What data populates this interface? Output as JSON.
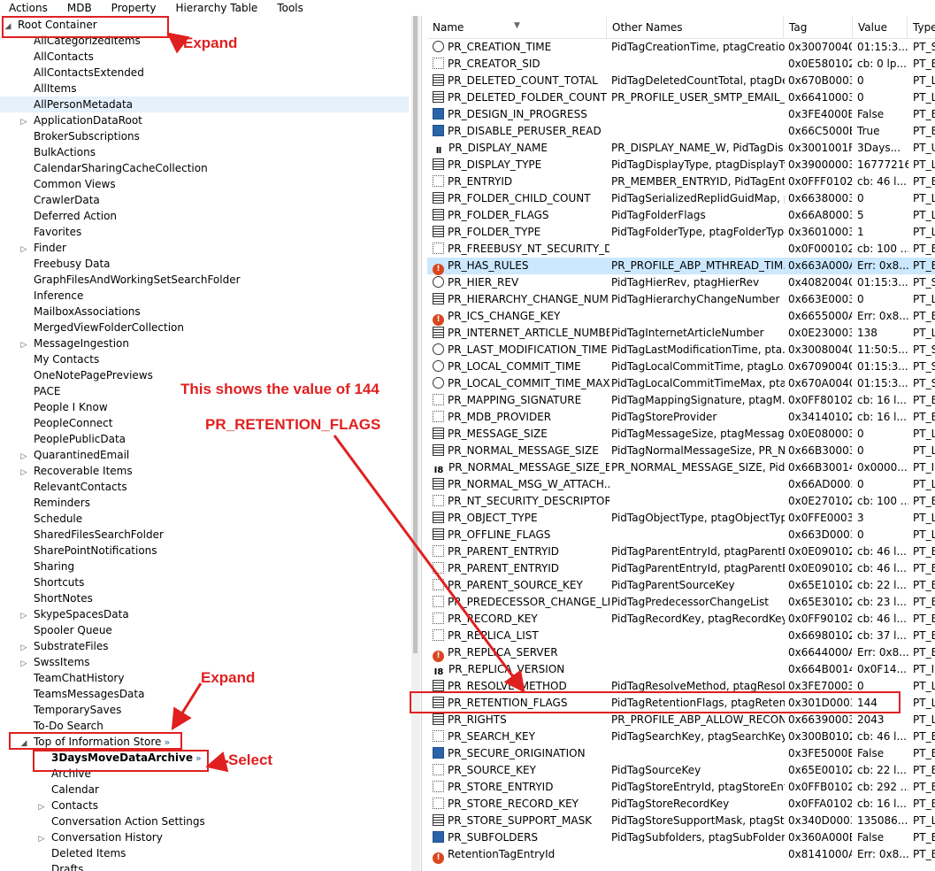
{
  "menu": [
    "Actions",
    "MDB",
    "Property",
    "Hierarchy Table",
    "Tools"
  ],
  "tree": [
    {
      "label": "Root Container",
      "level": 0,
      "expander": "open"
    },
    {
      "label": "AllCategorizedItems",
      "level": 2,
      "expander": ""
    },
    {
      "label": "AllContacts",
      "level": 2,
      "expander": ""
    },
    {
      "label": "AllContactsExtended",
      "level": 2,
      "expander": ""
    },
    {
      "label": "AllItems",
      "level": 2,
      "expander": ""
    },
    {
      "label": "AllPersonMetadata",
      "level": 2,
      "expander": "",
      "highlighted": true
    },
    {
      "label": "ApplicationDataRoot",
      "level": 2,
      "expander": "closed"
    },
    {
      "label": "BrokerSubscriptions",
      "level": 2,
      "expander": ""
    },
    {
      "label": "BulkActions",
      "level": 2,
      "expander": ""
    },
    {
      "label": "CalendarSharingCacheCollection",
      "level": 2,
      "expander": ""
    },
    {
      "label": "Common Views",
      "level": 2,
      "expander": ""
    },
    {
      "label": "CrawlerData",
      "level": 2,
      "expander": ""
    },
    {
      "label": "Deferred Action",
      "level": 2,
      "expander": ""
    },
    {
      "label": "Favorites",
      "level": 2,
      "expander": ""
    },
    {
      "label": "Finder",
      "level": 2,
      "expander": "closed"
    },
    {
      "label": "Freebusy Data",
      "level": 2,
      "expander": ""
    },
    {
      "label": "GraphFilesAndWorkingSetSearchFolder",
      "level": 2,
      "expander": ""
    },
    {
      "label": "Inference",
      "level": 2,
      "expander": ""
    },
    {
      "label": "MailboxAssociations",
      "level": 2,
      "expander": ""
    },
    {
      "label": "MergedViewFolderCollection",
      "level": 2,
      "expander": ""
    },
    {
      "label": "MessageIngestion",
      "level": 2,
      "expander": "closed"
    },
    {
      "label": "My Contacts",
      "level": 2,
      "expander": ""
    },
    {
      "label": "OneNotePagePreviews",
      "level": 2,
      "expander": ""
    },
    {
      "label": "PACE",
      "level": 2,
      "expander": ""
    },
    {
      "label": "People I Know",
      "level": 2,
      "expander": ""
    },
    {
      "label": "PeopleConnect",
      "level": 2,
      "expander": ""
    },
    {
      "label": "PeoplePublicData",
      "level": 2,
      "expander": ""
    },
    {
      "label": "QuarantinedEmail",
      "level": 2,
      "expander": "closed"
    },
    {
      "label": "Recoverable Items",
      "level": 2,
      "expander": "closed"
    },
    {
      "label": "RelevantContacts",
      "level": 2,
      "expander": ""
    },
    {
      "label": "Reminders",
      "level": 2,
      "expander": ""
    },
    {
      "label": "Schedule",
      "level": 2,
      "expander": ""
    },
    {
      "label": "SharedFilesSearchFolder",
      "level": 2,
      "expander": ""
    },
    {
      "label": "SharePointNotifications",
      "level": 2,
      "expander": ""
    },
    {
      "label": "Sharing",
      "level": 2,
      "expander": ""
    },
    {
      "label": "Shortcuts",
      "level": 2,
      "expander": ""
    },
    {
      "label": "ShortNotes",
      "level": 2,
      "expander": ""
    },
    {
      "label": "SkypeSpacesData",
      "level": 2,
      "expander": "closed"
    },
    {
      "label": "Spooler Queue",
      "level": 2,
      "expander": ""
    },
    {
      "label": "SubstrateFiles",
      "level": 2,
      "expander": "closed"
    },
    {
      "label": "SwssItems",
      "level": 2,
      "expander": "closed"
    },
    {
      "label": "TeamChatHistory",
      "level": 2,
      "expander": ""
    },
    {
      "label": "TeamsMessagesData",
      "level": 2,
      "expander": ""
    },
    {
      "label": "TemporarySaves",
      "level": 2,
      "expander": ""
    },
    {
      "label": "To-Do Search",
      "level": 2,
      "expander": ""
    },
    {
      "label": "Top of Information Store",
      "level": 1,
      "expander": "open",
      "badge": "»"
    },
    {
      "label": "3DaysMoveDataArchive",
      "level": 3,
      "expander": "",
      "bold": true,
      "badge": "»"
    },
    {
      "label": "Archive",
      "level": 3,
      "expander": ""
    },
    {
      "label": "Calendar",
      "level": 3,
      "expander": ""
    },
    {
      "label": "Contacts",
      "level": 3,
      "expander": "closed"
    },
    {
      "label": "Conversation Action Settings",
      "level": 3,
      "expander": ""
    },
    {
      "label": "Conversation History",
      "level": 3,
      "expander": "closed"
    },
    {
      "label": "Deleted Items",
      "level": 3,
      "expander": ""
    },
    {
      "label": "Drafts",
      "level": 3,
      "expander": ""
    }
  ],
  "columns": [
    "Name",
    "Other Names",
    "Tag",
    "Value",
    "Type"
  ],
  "properties": [
    {
      "icon": "clock",
      "name": "PR_CREATION_TIME",
      "other": "PidTagCreationTime, ptagCreatio...",
      "tag": "0x30070040",
      "value": "01:15:3...",
      "type": "PT_S"
    },
    {
      "icon": "binary",
      "name": "PR_CREATOR_SID",
      "other": "",
      "tag": "0x0E580102",
      "value": "cb: 0 lp...",
      "type": "PT_B"
    },
    {
      "icon": "long",
      "name": "PR_DELETED_COUNT_TOTAL",
      "other": "PidTagDeletedCountTotal, ptagDe...",
      "tag": "0x670B0003",
      "value": "0",
      "type": "PT_L"
    },
    {
      "icon": "long",
      "name": "PR_DELETED_FOLDER_COUNT",
      "other": "PR_PROFILE_USER_SMTP_EMAIL_...",
      "tag": "0x66410003",
      "value": "0",
      "type": "PT_L"
    },
    {
      "icon": "bool",
      "name": "PR_DESIGN_IN_PROGRESS",
      "other": "",
      "tag": "0x3FE4000B",
      "value": "False",
      "type": "PT_B"
    },
    {
      "icon": "bool",
      "name": "PR_DISABLE_PERUSER_READ",
      "other": "",
      "tag": "0x66C5000B",
      "value": "True",
      "type": "PT_B"
    },
    {
      "icon": "text",
      "name": "PR_DISPLAY_NAME",
      "other": "PR_DISPLAY_NAME_W, PidTagDis...",
      "tag": "0x3001001F",
      "value": "3Days...",
      "type": "PT_U"
    },
    {
      "icon": "long",
      "name": "PR_DISPLAY_TYPE",
      "other": "PidTagDisplayType, ptagDisplayTy...",
      "tag": "0x39000003",
      "value": "16777216",
      "type": "PT_L"
    },
    {
      "icon": "binary",
      "name": "PR_ENTRYID",
      "other": "PR_MEMBER_ENTRYID, PidTagEnt...",
      "tag": "0x0FFF0102",
      "value": "cb: 46 l...",
      "type": "PT_B"
    },
    {
      "icon": "long",
      "name": "PR_FOLDER_CHILD_COUNT",
      "other": "PidTagSerializedReplidGuidMap, p...",
      "tag": "0x66380003",
      "value": "0",
      "type": "PT_L"
    },
    {
      "icon": "long",
      "name": "PR_FOLDER_FLAGS",
      "other": "PidTagFolderFlags",
      "tag": "0x66A80003",
      "value": "5",
      "type": "PT_L"
    },
    {
      "icon": "long",
      "name": "PR_FOLDER_TYPE",
      "other": "PidTagFolderType, ptagFolderType",
      "tag": "0x36010003",
      "value": "1",
      "type": "PT_L"
    },
    {
      "icon": "binary",
      "name": "PR_FREEBUSY_NT_SECURITY_DE...",
      "other": "",
      "tag": "0x0F000102",
      "value": "cb: 100 ...",
      "type": "PT_B"
    },
    {
      "icon": "err",
      "name": "PR_HAS_RULES",
      "other": "PR_PROFILE_ABP_MTHREAD_TIM...",
      "tag": "0x663A000A",
      "value": "Err: 0x8...",
      "type": "PT_E",
      "selected": true
    },
    {
      "icon": "clock",
      "name": "PR_HIER_REV",
      "other": "PidTagHierRev, ptagHierRev",
      "tag": "0x40820040",
      "value": "01:15:3...",
      "type": "PT_S"
    },
    {
      "icon": "long",
      "name": "PR_HIERARCHY_CHANGE_NUM",
      "other": "PidTagHierarchyChangeNumber",
      "tag": "0x663E0003",
      "value": "0",
      "type": "PT_L"
    },
    {
      "icon": "err",
      "name": "PR_ICS_CHANGE_KEY",
      "other": "",
      "tag": "0x6655000A",
      "value": "Err: 0x8...",
      "type": "PT_E"
    },
    {
      "icon": "long",
      "name": "PR_INTERNET_ARTICLE_NUMBER",
      "other": "PidTagInternetArticleNumber",
      "tag": "0x0E230003",
      "value": "138",
      "type": "PT_L"
    },
    {
      "icon": "clock",
      "name": "PR_LAST_MODIFICATION_TIME",
      "other": "PidTagLastModificationTime, pta...",
      "tag": "0x30080040",
      "value": "11:50:5...",
      "type": "PT_S"
    },
    {
      "icon": "clock",
      "name": "PR_LOCAL_COMMIT_TIME",
      "other": "PidTagLocalCommitTime, ptagLo...",
      "tag": "0x67090040",
      "value": "01:15:3...",
      "type": "PT_S"
    },
    {
      "icon": "clock",
      "name": "PR_LOCAL_COMMIT_TIME_MAX",
      "other": "PidTagLocalCommitTimeMax, pta...",
      "tag": "0x670A0040",
      "value": "01:15:3...",
      "type": "PT_S"
    },
    {
      "icon": "binary",
      "name": "PR_MAPPING_SIGNATURE",
      "other": "PidTagMappingSignature, ptagM...",
      "tag": "0x0FF80102",
      "value": "cb: 16 l...",
      "type": "PT_B"
    },
    {
      "icon": "binary",
      "name": "PR_MDB_PROVIDER",
      "other": "PidTagStoreProvider",
      "tag": "0x34140102",
      "value": "cb: 16 l...",
      "type": "PT_B"
    },
    {
      "icon": "long",
      "name": "PR_MESSAGE_SIZE",
      "other": "PidTagMessageSize, ptagMessage...",
      "tag": "0x0E080003",
      "value": "0",
      "type": "PT_L"
    },
    {
      "icon": "long",
      "name": "PR_NORMAL_MESSAGE_SIZE",
      "other": "PidTagNormalMessageSize, PR_N...",
      "tag": "0x66B30003",
      "value": "0",
      "type": "PT_L"
    },
    {
      "icon": "i8",
      "name": "PR_NORMAL_MESSAGE_SIZE_E...",
      "other": "PR_NORMAL_MESSAGE_SIZE, Pid...",
      "tag": "0x66B30014",
      "value": "0x0000...",
      "type": "PT_I8"
    },
    {
      "icon": "long",
      "name": "PR_NORMAL_MSG_W_ATTACH...",
      "other": "",
      "tag": "0x66AD0003",
      "value": "0",
      "type": "PT_L"
    },
    {
      "icon": "binary",
      "name": "PR_NT_SECURITY_DESCRIPTOR",
      "other": "",
      "tag": "0x0E270102",
      "value": "cb: 100 ...",
      "type": "PT_B"
    },
    {
      "icon": "long",
      "name": "PR_OBJECT_TYPE",
      "other": "PidTagObjectType, ptagObjectType",
      "tag": "0x0FFE0003",
      "value": "3",
      "type": "PT_L"
    },
    {
      "icon": "long",
      "name": "PR_OFFLINE_FLAGS",
      "other": "",
      "tag": "0x663D0003",
      "value": "0",
      "type": "PT_L"
    },
    {
      "icon": "binary",
      "name": "PR_PARENT_ENTRYID",
      "other": "PidTagParentEntryId, ptagParentE...",
      "tag": "0x0E090102",
      "value": "cb: 46 l...",
      "type": "PT_B"
    },
    {
      "icon": "binary",
      "name": "PR_PARENT_ENTRYID",
      "other": "PidTagParentEntryId, ptagParentE...",
      "tag": "0x0E090102",
      "value": "cb: 46 l...",
      "type": "PT_B"
    },
    {
      "icon": "binary",
      "name": "PR_PARENT_SOURCE_KEY",
      "other": "PidTagParentSourceKey",
      "tag": "0x65E10102",
      "value": "cb: 22 l...",
      "type": "PT_B"
    },
    {
      "icon": "binary",
      "name": "PR_PREDECESSOR_CHANGE_LIST",
      "other": "PidTagPredecessorChangeList",
      "tag": "0x65E30102",
      "value": "cb: 23 l...",
      "type": "PT_B"
    },
    {
      "icon": "binary",
      "name": "PR_RECORD_KEY",
      "other": "PidTagRecordKey, ptagRecordKey",
      "tag": "0x0FF90102",
      "value": "cb: 46 l...",
      "type": "PT_B"
    },
    {
      "icon": "binary",
      "name": "PR_REPLICA_LIST",
      "other": "",
      "tag": "0x66980102",
      "value": "cb: 37 l...",
      "type": "PT_B"
    },
    {
      "icon": "err",
      "name": "PR_REPLICA_SERVER",
      "other": "",
      "tag": "0x6644000A",
      "value": "Err: 0x8...",
      "type": "PT_E"
    },
    {
      "icon": "i8",
      "name": "PR_REPLICA_VERSION",
      "other": "",
      "tag": "0x664B0014",
      "value": "0x0F14...",
      "type": "PT_I8"
    },
    {
      "icon": "long",
      "name": "PR_RESOLVE_METHOD",
      "other": "PidTagResolveMethod, ptagResol...",
      "tag": "0x3FE70003",
      "value": "0",
      "type": "PT_L"
    },
    {
      "icon": "long",
      "name": "PR_RETENTION_FLAGS",
      "other": "PidTagRetentionFlags, ptagRetent...",
      "tag": "0x301D0003",
      "value": "144",
      "type": "PT_L"
    },
    {
      "icon": "long",
      "name": "PR_RIGHTS",
      "other": "PR_PROFILE_ABP_ALLOW_RECON...",
      "tag": "0x66390003",
      "value": "2043",
      "type": "PT_L"
    },
    {
      "icon": "binary",
      "name": "PR_SEARCH_KEY",
      "other": "PidTagSearchKey, ptagSearchKey",
      "tag": "0x300B0102",
      "value": "cb: 46 l...",
      "type": "PT_B"
    },
    {
      "icon": "bool",
      "name": "PR_SECURE_ORIGINATION",
      "other": "",
      "tag": "0x3FE5000B",
      "value": "False",
      "type": "PT_B"
    },
    {
      "icon": "binary",
      "name": "PR_SOURCE_KEY",
      "other": "PidTagSourceKey",
      "tag": "0x65E00102",
      "value": "cb: 22 l...",
      "type": "PT_B"
    },
    {
      "icon": "binary",
      "name": "PR_STORE_ENTRYID",
      "other": "PidTagStoreEntryId, ptagStoreEntr...",
      "tag": "0x0FFB0102",
      "value": "cb: 292 ...",
      "type": "PT_B"
    },
    {
      "icon": "binary",
      "name": "PR_STORE_RECORD_KEY",
      "other": "PidTagStoreRecordKey",
      "tag": "0x0FFA0102",
      "value": "cb: 16 l...",
      "type": "PT_B"
    },
    {
      "icon": "long",
      "name": "PR_STORE_SUPPORT_MASK",
      "other": "PidTagStoreSupportMask, ptagSto...",
      "tag": "0x340D0003",
      "value": "135086...",
      "type": "PT_L"
    },
    {
      "icon": "bool",
      "name": "PR_SUBFOLDERS",
      "other": "PidTagSubfolders, ptagSubFolders",
      "tag": "0x360A000B",
      "value": "False",
      "type": "PT_B"
    },
    {
      "icon": "err",
      "name": "RetentionTagEntryId",
      "other": "",
      "tag": "0x8141000A",
      "value": "Err: 0x8...",
      "type": "PT_E"
    }
  ],
  "annotations": {
    "expand_top": "Expand",
    "expand_bottom": "Expand",
    "select": "Select",
    "note_line1": "This shows the value of 144",
    "note_line2": "PR_RETENTION_FLAGS",
    "color": "#e02020"
  }
}
